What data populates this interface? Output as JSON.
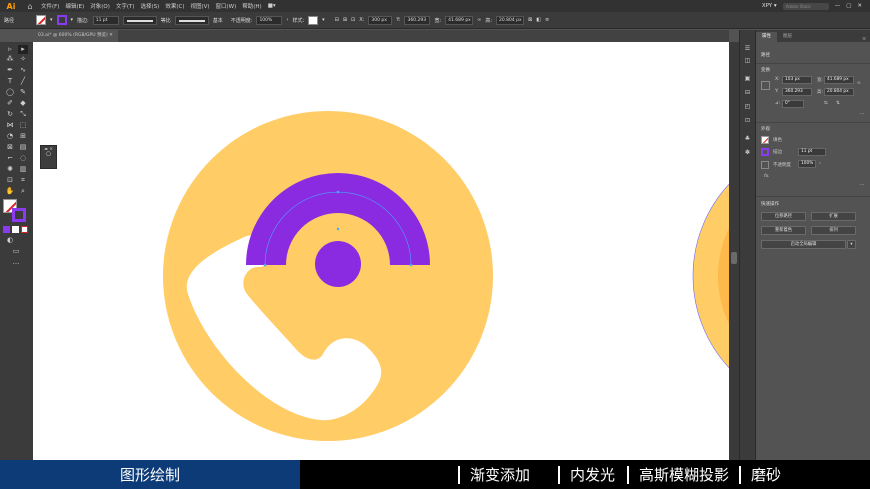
{
  "app": {
    "logo": "Ai",
    "home_icon": "home-icon"
  },
  "menu": [
    "文件(F)",
    "编辑(E)",
    "对象(O)",
    "文字(T)",
    "选择(S)",
    "效果(C)",
    "视图(V)",
    "窗口(W)",
    "帮助(H)"
  ],
  "menu_extra": "■▾",
  "menu_right": {
    "workspace": "XPY ▾",
    "search_placeholder": "Adobe Stock"
  },
  "control": {
    "selection_label": "路径",
    "stroke_label": "描边:",
    "stroke_value": "11 pt",
    "brush_label": "等比",
    "profile_label": "基本",
    "opacity_label": "不透明度:",
    "opacity_value": "100%",
    "style_label": "样式:",
    "x_value": "300 px",
    "y_value": "360.293",
    "w_value": "41.689 px",
    "h_value": "20.804 px"
  },
  "document_tab": "03.ai* @ 600% (RGB/GPU 预览)",
  "panel": {
    "tabs": [
      "属性",
      "图层"
    ],
    "section_path": "路径",
    "section_transform": "变换",
    "x_label": "X:",
    "x_value": "103 px",
    "y_label": "Y:",
    "y_value": "360.293",
    "w_label": "宽:",
    "w_value": "41.689 px",
    "h_label": "高:",
    "h_value": "20.804 px",
    "angle_label": "⊿:",
    "angle_value": "0°",
    "section_appearance": "外观",
    "fill_label": "填色",
    "stroke_label": "描边",
    "stroke_value": "11 pt",
    "opacity_label": "不透明度",
    "opacity_value": "100%",
    "fx_label": "fx.",
    "section_quick": "快速操作",
    "btn_offset": "位移路径",
    "btn_expand": "扩展",
    "btn_recolor": "重新着色",
    "btn_arrange": "排列",
    "btn_image_trace": "启动全局编辑",
    "more": "..."
  },
  "colors": {
    "yellow": "#FFCC66",
    "purple": "#8A2BE2",
    "white": "#FFFFFF",
    "bottom_first": "#0C3B78"
  },
  "bottom_bar": [
    "图形绘制",
    "渐变添加",
    "内发光",
    "高斯模糊投影",
    "磨砂"
  ]
}
